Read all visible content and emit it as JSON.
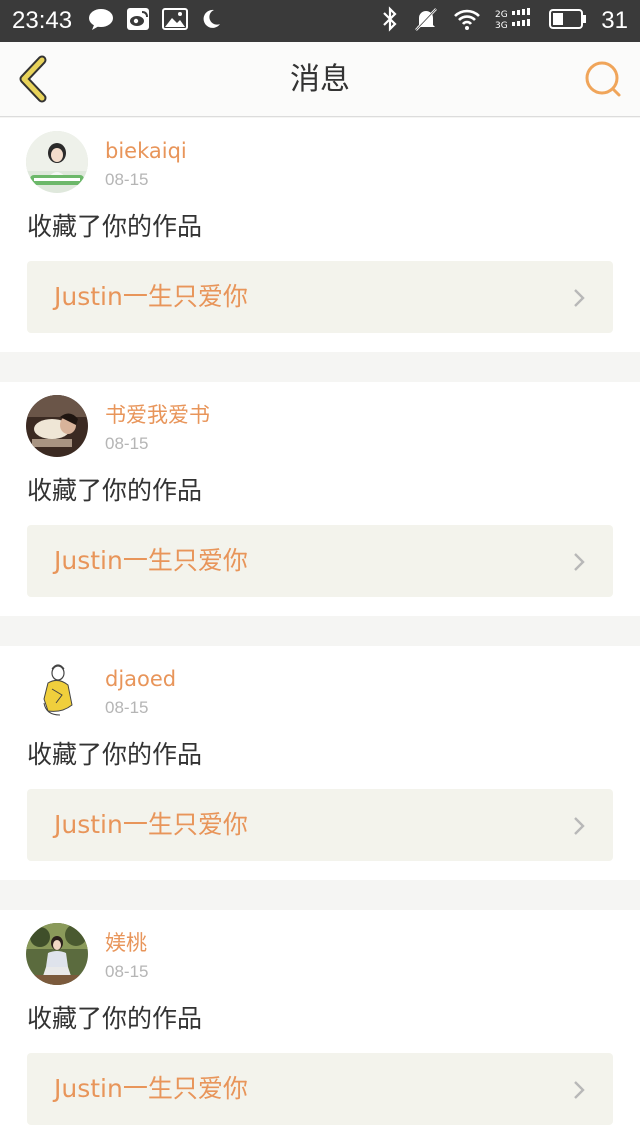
{
  "status_bar": {
    "time": "23:43",
    "battery": "31",
    "left_icons": [
      "chat-bubble-icon",
      "weibo-icon",
      "image-icon",
      "moon-icon"
    ],
    "right_icons": [
      "bluetooth-icon",
      "mute-icon",
      "wifi-icon",
      "signal-icon",
      "battery-icon"
    ]
  },
  "header": {
    "title": "消息",
    "accent": "#e8d35a"
  },
  "messages": [
    {
      "username": "biekaiqi",
      "date": "08-15",
      "action": "收藏了你的作品",
      "work_title": "Justin一生只爱你"
    },
    {
      "username": "书爱我爱书",
      "date": "08-15",
      "action": "收藏了你的作品",
      "work_title": "Justin一生只爱你"
    },
    {
      "username": "djaoed",
      "date": "08-15",
      "action": "收藏了你的作品",
      "work_title": "Justin一生只爱你"
    },
    {
      "username": "媄桃",
      "date": "08-15",
      "action": "收藏了你的作品",
      "work_title": "Justin一生只爱你"
    }
  ],
  "colors": {
    "username": "#e8955a",
    "link_bg": "#f3f3ec",
    "status_bar_bg": "#3a3a3a"
  }
}
